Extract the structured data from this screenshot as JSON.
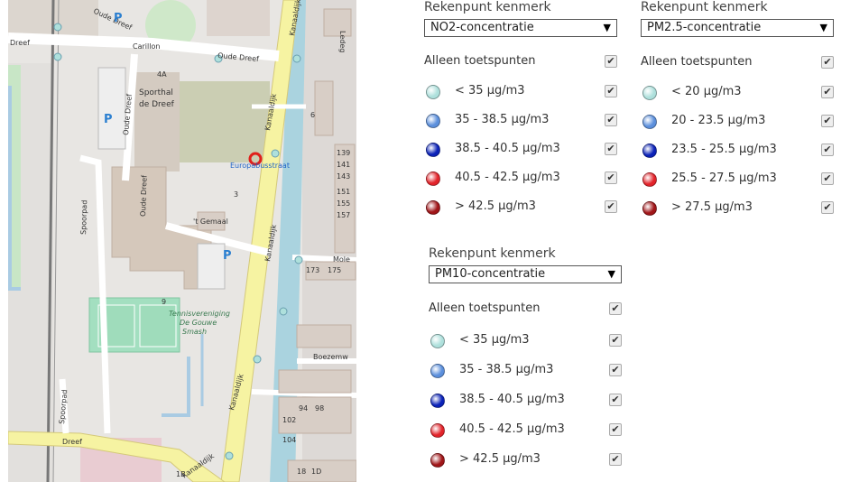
{
  "map": {
    "labels": {
      "street_oude_dreef_top": "Oude Dreef",
      "street_dreef": "Dreef",
      "carillon": "Carillon",
      "oude_dreef_right": "Oude Dreef",
      "kanaaldijk_top": "Kanaaldijk",
      "ledeg": "Ledeg",
      "label_4a": "4A",
      "sporthal": "Sporthal",
      "sporthal2": "de Dreef",
      "oude_dreef_vert": "Oude Dreef",
      "kanaaldijk_mid": "Kanaaldijk",
      "euro_label": "Europabusstraat",
      "spoorpad": "Spoorpad",
      "oude_dreef_vert2": "Oude Dreef",
      "gemaal": "'t Gemaal",
      "kanaaldijk_low": "Kanaaldijk",
      "mole": "Mole",
      "tennis1": "Tennisvereniging",
      "tennis2": "De Gouwe",
      "tennis3": "Smash",
      "boezem": "Boezemw",
      "spoorpad2": "Spoorpad",
      "dreef_bottom": "Dreef",
      "kanaaldijk_bottom": "Kanaaldijk",
      "kanaaldijk_bottom2": "Kanaaldijk",
      "parking": "P",
      "num_139": "139",
      "num_141": "141",
      "num_143": "143",
      "num_151": "151",
      "num_155": "155",
      "num_157": "157",
      "num_3": "3",
      "num_9": "9",
      "num_6": "6",
      "num_173": "173",
      "num_175": "175",
      "num_94": "94",
      "num_98": "98",
      "num_104": "104",
      "num_102": "102",
      "num_18": "18",
      "num_1d": "1D",
      "num_1b": "1B"
    }
  },
  "panels": [
    {
      "title": "Rekenpunt kenmerk",
      "select": "NO2-concentratie",
      "only_label": "Alleen toetspunten",
      "items": [
        "< 35 µg/m3",
        "35 - 38.5 µg/m3",
        "38.5 - 40.5 µg/m3",
        "40.5 - 42.5 µg/m3",
        "> 42.5 µg/m3"
      ]
    },
    {
      "title": "Rekenpunt kenmerk",
      "select": "PM2.5-concentratie",
      "only_label": "Alleen toetspunten",
      "items": [
        "< 20 µg/m3",
        "20 - 23.5 µg/m3",
        "23.5 - 25.5 µg/m3",
        "25.5 - 27.5 µg/m3",
        "> 27.5 µg/m3"
      ]
    },
    {
      "title": "Rekenpunt kenmerk",
      "select": "PM10-concentratie",
      "only_label": "Alleen toetspunten",
      "items": [
        "< 35 µg/m3",
        "35 - 38.5 µg/m3",
        "38.5 - 40.5 µg/m3",
        "40.5 - 42.5 µg/m3",
        "> 42.5 µg/m3"
      ]
    }
  ],
  "dot_colors": [
    "#aee0dc",
    "#5b8fdc",
    "#0b22b8",
    "#e2232a",
    "#a01518"
  ],
  "check_glyph": "✔",
  "arrow_glyph": "▼"
}
